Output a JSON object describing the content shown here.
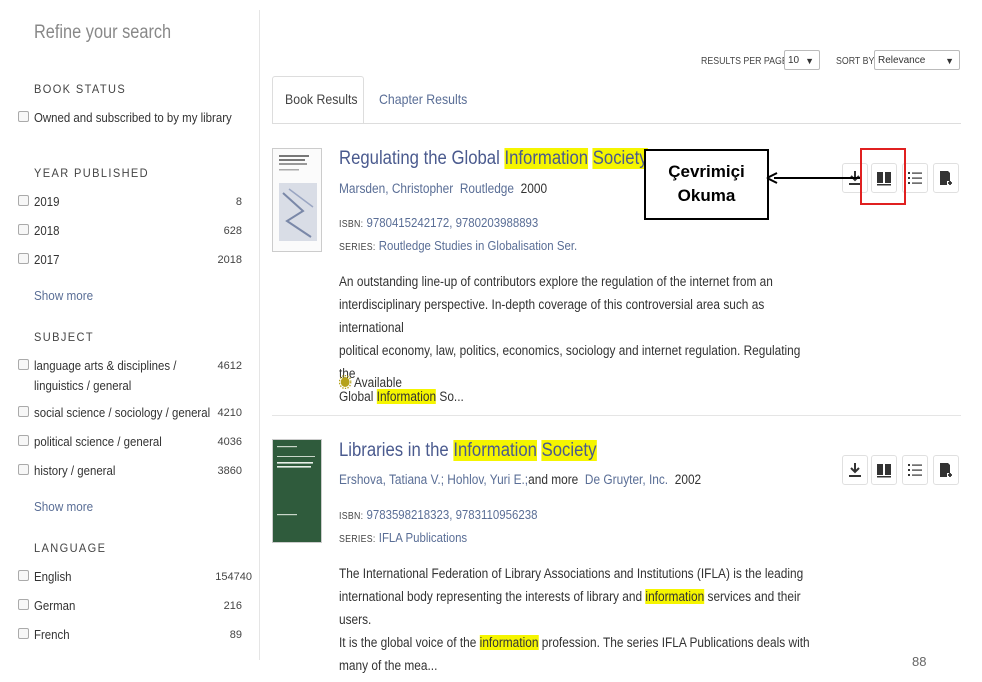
{
  "sidebar": {
    "title": "Refine your search",
    "book_status": {
      "heading": "BOOK STATUS",
      "options": [
        {
          "label": "Owned and subscribed to by my library"
        }
      ]
    },
    "year_published": {
      "heading": "YEAR PUBLISHED",
      "options": [
        {
          "label": "2019",
          "count": "8"
        },
        {
          "label": "2018",
          "count": "628"
        },
        {
          "label": "2017",
          "count": "2018"
        }
      ],
      "show_more": "Show more"
    },
    "subject": {
      "heading": "SUBJECT",
      "options": [
        {
          "label": "language arts & disciplines / linguistics / general",
          "count": "4612"
        },
        {
          "label": "social science / sociology / general",
          "count": "4210"
        },
        {
          "label": "political science / general",
          "count": "4036"
        },
        {
          "label": "history / general",
          "count": "3860"
        }
      ],
      "show_more": "Show more"
    },
    "language": {
      "heading": "LANGUAGE",
      "options": [
        {
          "label": "English",
          "count": "154740"
        },
        {
          "label": "German",
          "count": "216"
        },
        {
          "label": "French",
          "count": "89"
        }
      ]
    }
  },
  "controls": {
    "results_per_page_label": "RESULTS PER PAGE",
    "results_per_page_value": "10",
    "sort_by_label": "SORT BY",
    "sort_by_value": "Relevance"
  },
  "tabs": [
    {
      "label": "Book Results",
      "active": true
    },
    {
      "label": "Chapter Results",
      "active": false
    }
  ],
  "results": [
    {
      "title_parts": [
        "Regulating the Global ",
        "Information",
        " ",
        "Society"
      ],
      "authors": "Marsden, Christopher",
      "publisher": "Routledge",
      "year": "2000",
      "isbn_label": "ISBN:",
      "isbn": "9780415242172, 9780203988893",
      "series_label": "SERIES:",
      "series": "Routledge Studies in Globalisation Ser.",
      "description": [
        "An outstanding line-up of contributors explore the regulation of the internet from an",
        "interdisciplinary perspective. In-depth coverage of this controversial area such as international",
        "political economy, law, politics, economics, sociology and internet regulation. Regulating the"
      ],
      "description_last": [
        "Global ",
        "Information",
        " So..."
      ],
      "availability": "Available"
    },
    {
      "title_parts": [
        "Libraries in the ",
        "Information",
        " ",
        "Society"
      ],
      "authors": "Ershova, Tatiana V.; Hohlov, Yuri E.;",
      "and_more": "and more",
      "publisher": "De Gruyter, Inc.",
      "year": "2002",
      "isbn_label": "ISBN:",
      "isbn": "9783598218323, 9783110956238",
      "series_label": "SERIES:",
      "series": "IFLA Publications",
      "description_lines": [
        [
          "The International Federation of Library Associations and Institutions (IFLA) is the leading"
        ],
        [
          "international body representing the interests of library and ",
          "information",
          " services and their users."
        ],
        [
          "It is the global voice of the ",
          "information",
          " profession. The series IFLA Publications deals with"
        ],
        [
          "many of the mea..."
        ]
      ],
      "cover_text": "LIBRARIES IN THE INFORMATION SOCIETY"
    }
  ],
  "callout": {
    "line1": "Çevrimiçi",
    "line2": "Okuma"
  },
  "page_number": "88",
  "colors": {
    "highlight": "#f5f500",
    "link": "#4a5a8e",
    "callout_box": "#e02020"
  }
}
